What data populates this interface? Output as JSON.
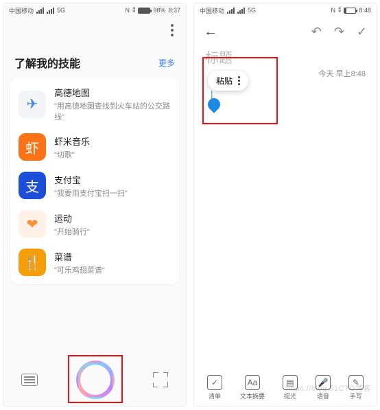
{
  "left": {
    "status": {
      "carrier": "中国移动",
      "net": "5G",
      "batt_pct": "98%",
      "time": "8:37",
      "nfc": "N",
      "bt": "⁑"
    },
    "section_title": "了解我的技能",
    "more_label": "更多",
    "items": [
      {
        "icon_bg": "#f3f4f6",
        "icon_glyph": "✈",
        "icon_color": "#3b82f6",
        "title": "高德地图",
        "sub": "\"用高德地图查找到火车站的公交路线\""
      },
      {
        "icon_bg": "#f97316",
        "icon_glyph": "虾",
        "icon_color": "#fff",
        "title": "虾米音乐",
        "sub": "\"切歌\""
      },
      {
        "icon_bg": "#1d4ed8",
        "icon_glyph": "支",
        "icon_color": "#fff",
        "title": "支付宝",
        "sub": "\"我要用支付宝扫一扫\""
      },
      {
        "icon_bg": "#fff0e8",
        "icon_glyph": "❤",
        "icon_color": "#fb923c",
        "title": "运动",
        "sub": "\"开始骑行\""
      },
      {
        "icon_bg": "#f59e0b",
        "icon_glyph": "🍴",
        "icon_color": "#fff",
        "title": "菜谱",
        "sub": "\"可乐鸡翅菜谱\""
      }
    ]
  },
  "right": {
    "status": {
      "carrier": "中国移动",
      "net": "5G",
      "batt_pct": "14%",
      "time": "8:48",
      "nfc": "N",
      "bt": "⁑"
    },
    "title_placeholder": "标题",
    "timestamp": "今天 早上8:48",
    "paste_label": "粘贴",
    "tools": [
      {
        "label": "清单",
        "glyph": "✓"
      },
      {
        "label": "文本摘要",
        "glyph": "Aa"
      },
      {
        "label": "提光",
        "glyph": "▤"
      },
      {
        "label": "语音",
        "glyph": "🎤"
      },
      {
        "label": "手写",
        "glyph": "✎"
      }
    ],
    "nav": {
      "undo": "↶",
      "redo": "↷",
      "done": "✓"
    }
  },
  "watermark": "https://blog.51CTO博客"
}
